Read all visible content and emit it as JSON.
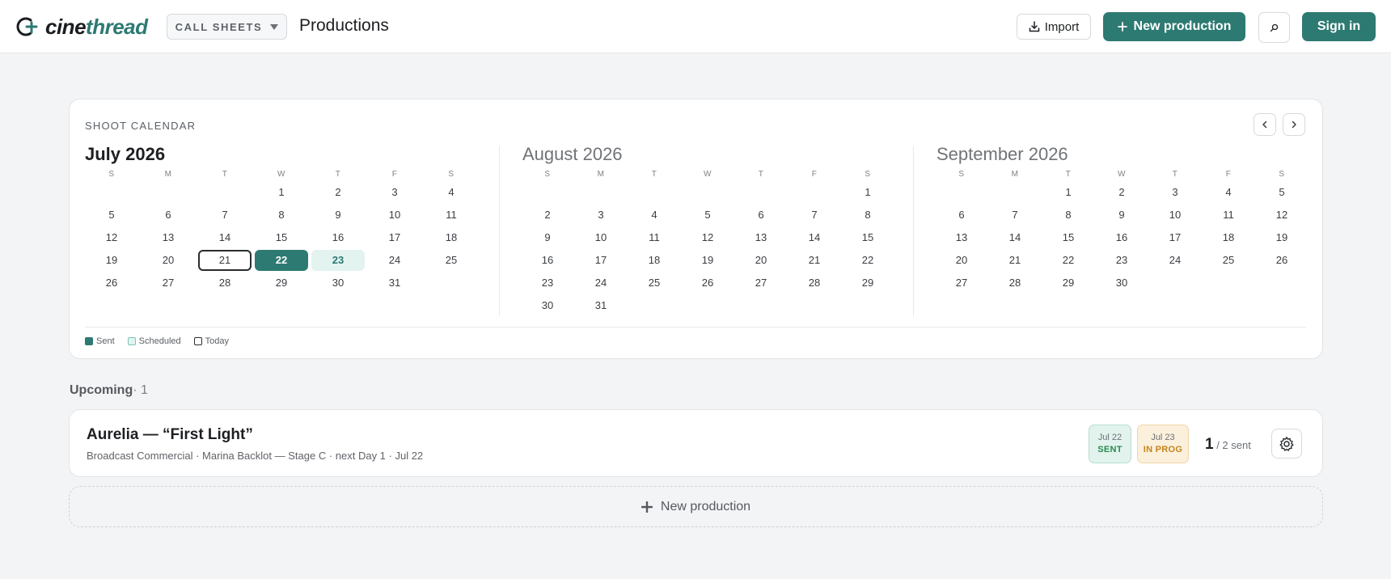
{
  "header": {
    "brand_prefix": "cine",
    "brand_suffix": "thread",
    "context_label": "CALL SHEETS",
    "page_title": "Productions",
    "import_label": "Import",
    "new_production_label": "New production",
    "sign_in_label": "Sign in",
    "search_icon": "search-icon",
    "accent_color": "#2d7a72"
  },
  "calendar": {
    "label": "SHOOT CALENDAR",
    "months": [
      {
        "title": "July 2026",
        "weekdays": [
          "S",
          "M",
          "T",
          "W",
          "T",
          "F",
          "S"
        ],
        "lead_blanks": 3,
        "days": [
          "1",
          "2",
          "3",
          "4",
          "5",
          "6",
          "7",
          "8",
          "9",
          "10",
          "11",
          "12",
          "13",
          "14",
          "15",
          "16",
          "17",
          "18",
          "19",
          "20",
          "21",
          "22",
          "23",
          "24",
          "25",
          "26",
          "27",
          "28",
          "29",
          "30",
          "31"
        ],
        "today": "21",
        "sent": [
          "22"
        ],
        "scheduled": [
          "23"
        ]
      },
      {
        "title": "August 2026",
        "weekdays": [
          "S",
          "M",
          "T",
          "W",
          "T",
          "F",
          "S"
        ],
        "lead_blanks": 6,
        "days": [
          "1",
          "2",
          "3",
          "4",
          "5",
          "6",
          "7",
          "8",
          "9",
          "10",
          "11",
          "12",
          "13",
          "14",
          "15",
          "16",
          "17",
          "18",
          "19",
          "20",
          "21",
          "22",
          "23",
          "24",
          "25",
          "26",
          "27",
          "28",
          "29",
          "30",
          "31"
        ],
        "today": "",
        "sent": [],
        "scheduled": []
      },
      {
        "title": "September 2026",
        "weekdays": [
          "S",
          "M",
          "T",
          "W",
          "T",
          "F",
          "S"
        ],
        "lead_blanks": 2,
        "days": [
          "1",
          "2",
          "3",
          "4",
          "5",
          "6",
          "7",
          "8",
          "9",
          "10",
          "11",
          "12",
          "13",
          "14",
          "15",
          "16",
          "17",
          "18",
          "19",
          "20",
          "21",
          "22",
          "23",
          "24",
          "25",
          "26",
          "27",
          "28",
          "29",
          "30"
        ],
        "today": "",
        "sent": [],
        "scheduled": []
      }
    ],
    "legend": {
      "sent": "Sent",
      "scheduled": "Scheduled",
      "today": "Today"
    },
    "colors": {
      "sent": "#2d7a72",
      "scheduled": "#e2f3f0"
    }
  },
  "upcoming": {
    "label": "Upcoming",
    "count_text": "· 1",
    "productions": [
      {
        "title": "Aurelia — “First Light”",
        "subtitle": "Broadcast Commercial · Marina Backlot — Stage C · next Day 1 · Jul 22",
        "chips": [
          {
            "date": "Jul 22",
            "status": "SENT"
          },
          {
            "date": "Jul 23",
            "status": "IN PROG"
          }
        ],
        "sent_count": "1",
        "sent_total": "/ 2 sent"
      }
    ],
    "new_production_label": "New production"
  }
}
